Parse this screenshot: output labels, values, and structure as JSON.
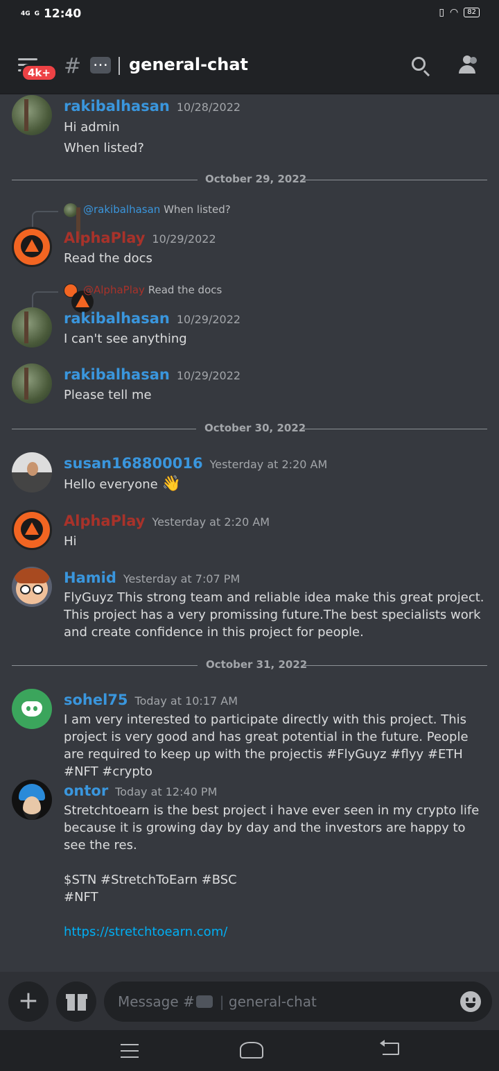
{
  "status_bar": {
    "time": "12:40",
    "network_1": "4G",
    "network_2": "G",
    "battery": "82"
  },
  "header": {
    "unread_badge": "4k+",
    "hash": "#",
    "channel_emoji_icon": "speech-bubble-icon",
    "channel_name": "general-chat"
  },
  "dividers": [
    "October 29, 2022",
    "October 30, 2022",
    "October 31, 2022"
  ],
  "messages": [
    {
      "author": "rakibalhasan",
      "time": "10/28/2022",
      "text": "Hi admin\nWhen listed?"
    },
    {
      "reply_to_author": "@rakibalhasan",
      "reply_to_text": "When listed?",
      "author": "AlphaPlay",
      "time": "10/29/2022",
      "text": "Read the docs"
    },
    {
      "reply_to_author": "@AlphaPlay",
      "reply_to_text": "Read the docs",
      "author": "rakibalhasan",
      "time": "10/29/2022",
      "text": "I can't see anything"
    },
    {
      "author": "rakibalhasan",
      "time": "10/29/2022",
      "text": "Please tell me"
    },
    {
      "author": "susan168800016",
      "time": "Yesterday at 2:20 AM",
      "text": "Hello everyone",
      "emoji": "👋"
    },
    {
      "author": "AlphaPlay",
      "time": "Yesterday at 2:20 AM",
      "text": "Hi"
    },
    {
      "author": "Hamid",
      "time": "Yesterday at 7:07 PM",
      "text": "FlyGuyz This strong team and reliable idea make this great project. This project has a very promissing future.The best specialists work and create confidence in this project for people."
    },
    {
      "author": "sohel75",
      "time": "Today at 10:17 AM",
      "text": "I am very interested to participate directly with this project. This project is very good and has great potential in the future. People are required to keep up with the projectis #FlyGuyz #flyy #ETH #NFT #crypto"
    },
    {
      "author": "ontor",
      "time": "Today at 12:40 PM",
      "text": "Stretchtoearn is the best project i have ever seen in my crypto life because it is growing day by day and the investors are happy to see the res.\n\n$STN #StretchToEarn  #BSC\n#NFT",
      "link": "https://stretchtoearn.com/"
    }
  ],
  "composer": {
    "placeholder_prefix": "Message #",
    "placeholder_channel": "general-chat"
  }
}
